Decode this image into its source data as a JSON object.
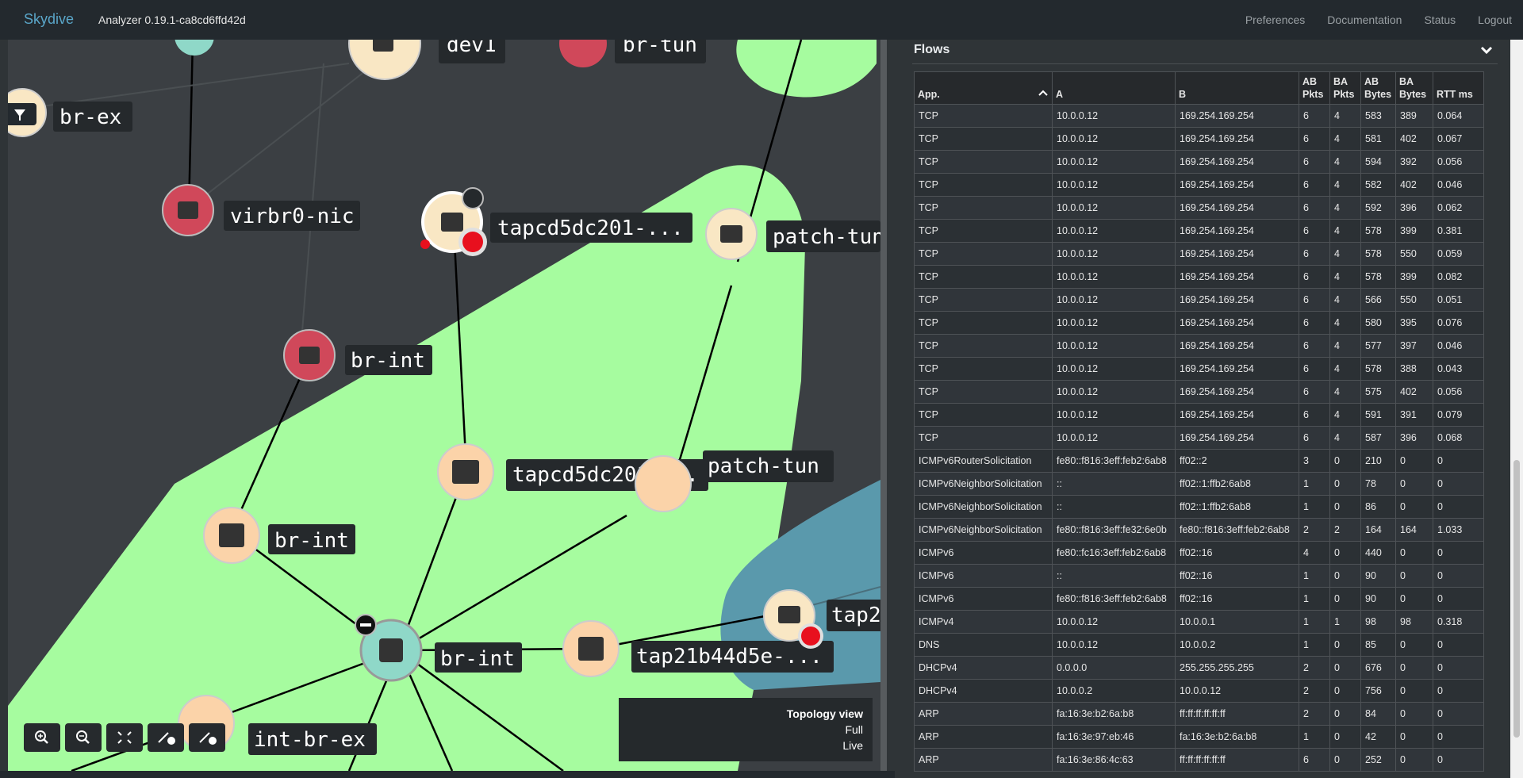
{
  "navbar": {
    "brand": "Skydive",
    "version": "Analyzer 0.19.1-ca8cd6ffd42d",
    "links": [
      "Preferences",
      "Documentation",
      "Status",
      "Logout"
    ]
  },
  "topology": {
    "nodes": [
      "dev1",
      "br-tun",
      "br-ex",
      "virbr0-nic",
      "tapcd5dc201-...",
      "patch-tun",
      "br-int",
      "tapcd5dc201-...",
      "patch-tun",
      "br-int",
      "br-int",
      "tap21b44d5e-...",
      "tap2",
      "int-br-ex"
    ],
    "legend": {
      "title": "Topology view",
      "line1": "Full",
      "line2": "Live"
    },
    "colors": {
      "green": "#a6fc9f",
      "blue": "#5a99ac",
      "red": "#d0485a",
      "cream": "#f9e7c4",
      "peach": "#fbd3a9",
      "teal": "#8fd8c8"
    },
    "icons": [
      "filter-icon",
      "zoom-in-icon",
      "zoom-out-icon",
      "fit-screen-icon",
      "expand-icon",
      "collapse-icon"
    ]
  },
  "flows": {
    "title": "Flows",
    "columns": [
      "App.",
      "A",
      "B",
      "AB Pkts",
      "BA Pkts",
      "AB Bytes",
      "BA Bytes",
      "RTT ms"
    ],
    "rows": [
      [
        "TCP",
        "10.0.0.12",
        "169.254.169.254",
        "6",
        "4",
        "583",
        "389",
        "0.064"
      ],
      [
        "TCP",
        "10.0.0.12",
        "169.254.169.254",
        "6",
        "4",
        "581",
        "402",
        "0.067"
      ],
      [
        "TCP",
        "10.0.0.12",
        "169.254.169.254",
        "6",
        "4",
        "594",
        "392",
        "0.056"
      ],
      [
        "TCP",
        "10.0.0.12",
        "169.254.169.254",
        "6",
        "4",
        "582",
        "402",
        "0.046"
      ],
      [
        "TCP",
        "10.0.0.12",
        "169.254.169.254",
        "6",
        "4",
        "592",
        "396",
        "0.062"
      ],
      [
        "TCP",
        "10.0.0.12",
        "169.254.169.254",
        "6",
        "4",
        "578",
        "399",
        "0.381"
      ],
      [
        "TCP",
        "10.0.0.12",
        "169.254.169.254",
        "6",
        "4",
        "578",
        "550",
        "0.059"
      ],
      [
        "TCP",
        "10.0.0.12",
        "169.254.169.254",
        "6",
        "4",
        "578",
        "399",
        "0.082"
      ],
      [
        "TCP",
        "10.0.0.12",
        "169.254.169.254",
        "6",
        "4",
        "566",
        "550",
        "0.051"
      ],
      [
        "TCP",
        "10.0.0.12",
        "169.254.169.254",
        "6",
        "4",
        "580",
        "395",
        "0.076"
      ],
      [
        "TCP",
        "10.0.0.12",
        "169.254.169.254",
        "6",
        "4",
        "577",
        "397",
        "0.046"
      ],
      [
        "TCP",
        "10.0.0.12",
        "169.254.169.254",
        "6",
        "4",
        "578",
        "388",
        "0.043"
      ],
      [
        "TCP",
        "10.0.0.12",
        "169.254.169.254",
        "6",
        "4",
        "575",
        "402",
        "0.056"
      ],
      [
        "TCP",
        "10.0.0.12",
        "169.254.169.254",
        "6",
        "4",
        "591",
        "391",
        "0.079"
      ],
      [
        "TCP",
        "10.0.0.12",
        "169.254.169.254",
        "6",
        "4",
        "587",
        "396",
        "0.068"
      ],
      [
        "ICMPv6RouterSolicitation",
        "fe80::f816:3eff:feb2:6ab8",
        "ff02::2",
        "3",
        "0",
        "210",
        "0",
        "0"
      ],
      [
        "ICMPv6NeighborSolicitation",
        "::",
        "ff02::1:ffb2:6ab8",
        "1",
        "0",
        "78",
        "0",
        "0"
      ],
      [
        "ICMPv6NeighborSolicitation",
        "::",
        "ff02::1:ffb2:6ab8",
        "1",
        "0",
        "86",
        "0",
        "0"
      ],
      [
        "ICMPv6NeighborSolicitation",
        "fe80::f816:3eff:fe32:6e0b",
        "fe80::f816:3eff:feb2:6ab8",
        "2",
        "2",
        "164",
        "164",
        "1.033"
      ],
      [
        "ICMPv6",
        "fe80::fc16:3eff:feb2:6ab8",
        "ff02::16",
        "4",
        "0",
        "440",
        "0",
        "0"
      ],
      [
        "ICMPv6",
        "::",
        "ff02::16",
        "1",
        "0",
        "90",
        "0",
        "0"
      ],
      [
        "ICMPv6",
        "fe80::f816:3eff:feb2:6ab8",
        "ff02::16",
        "1",
        "0",
        "90",
        "0",
        "0"
      ],
      [
        "ICMPv4",
        "10.0.0.12",
        "10.0.0.1",
        "1",
        "1",
        "98",
        "98",
        "0.318"
      ],
      [
        "DNS",
        "10.0.0.12",
        "10.0.0.2",
        "1",
        "0",
        "85",
        "0",
        "0"
      ],
      [
        "DHCPv4",
        "0.0.0.0",
        "255.255.255.255",
        "2",
        "0",
        "676",
        "0",
        "0"
      ],
      [
        "DHCPv4",
        "10.0.0.2",
        "10.0.0.12",
        "2",
        "0",
        "756",
        "0",
        "0"
      ],
      [
        "ARP",
        "fa:16:3e:b2:6a:b8",
        "ff:ff:ff:ff:ff:ff",
        "2",
        "0",
        "84",
        "0",
        "0"
      ],
      [
        "ARP",
        "fa:16:3e:97:eb:46",
        "fa:16:3e:b2:6a:b8",
        "1",
        "0",
        "42",
        "0",
        "0"
      ],
      [
        "ARP",
        "fa:16:3e:86:4c:63",
        "ff:ff:ff:ff:ff:ff",
        "6",
        "0",
        "252",
        "0",
        "0"
      ]
    ]
  }
}
